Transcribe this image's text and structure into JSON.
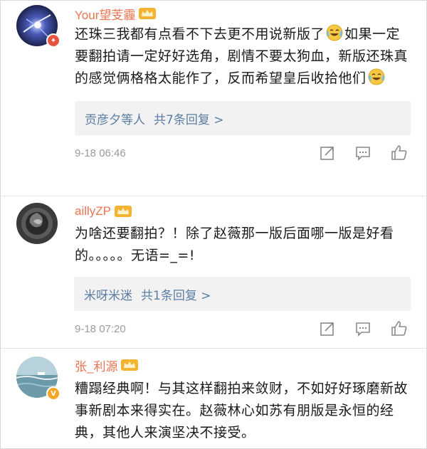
{
  "comments": [
    {
      "username": "Your望芰霾",
      "content_before_emoji1": "还珠三我都有点看不下去更不用说新版了",
      "content_middle": "如果一定要翻拍请一定好好选角，剧情不要太狗血，新版还珠真的感觉俩格格太能作了，反而希望皇后收拾他们",
      "replies_names": "贡彦夕等人",
      "replies_count": "共7条回复 >",
      "time": "9-18 06:46",
      "avatar_icon": "galaxy-avatar-icon",
      "badge_icon": "shield-badge-icon"
    },
    {
      "username": "aillyZP",
      "content": "为啥还要翻拍？！除了赵薇那一版后面哪一版是好看的。。。。。无语=_=!",
      "replies_names": "米呀米迷",
      "replies_count": "共1条回复 >",
      "time": "9-18 07:20",
      "avatar_icon": "rose-avatar-icon"
    },
    {
      "username": "张_利源",
      "content": "糟蹋经典啊！与其这样翻拍来敛财，不如好好琢磨新故事新剧本来得实在。赵薇林心如苏有朋版是永恒的经典，其他人来演坚决不接受。",
      "avatar_icon": "sea-avatar-icon",
      "badge_icon": "v-badge-icon"
    }
  ],
  "colors": {
    "username": "#eb7350",
    "link": "#5b7ea3",
    "time": "#9b9b9b",
    "reply_bg": "#f2f2f2"
  },
  "icons": [
    "crown-icon",
    "crying-laugh-emoji",
    "share-icon",
    "comment-icon",
    "like-icon"
  ]
}
